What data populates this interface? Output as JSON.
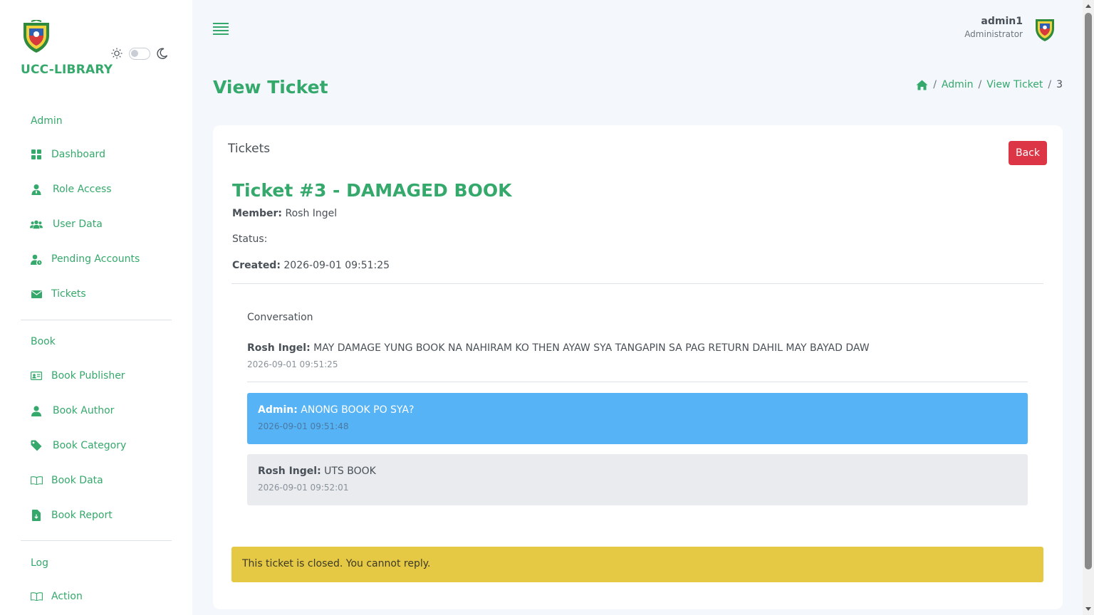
{
  "sidebar": {
    "brand": "UCC-LIBRARY",
    "logo_icon": "ucc-crest",
    "theme": {
      "light_icon": "sun-icon",
      "dark_icon": "moon-icon",
      "dark_mode": false
    },
    "sections": [
      {
        "title": "Admin",
        "items": [
          {
            "label": "Dashboard",
            "icon": "grid-icon"
          },
          {
            "label": "Role Access",
            "icon": "user-tie-icon"
          },
          {
            "label": "User Data",
            "icon": "users-icon"
          },
          {
            "label": "Pending Accounts",
            "icon": "user-clock-icon"
          },
          {
            "label": "Tickets",
            "icon": "envelope-icon"
          }
        ]
      },
      {
        "title": "Book",
        "items": [
          {
            "label": "Book Publisher",
            "icon": "id-card-icon"
          },
          {
            "label": "Book Author",
            "icon": "user-icon"
          },
          {
            "label": "Book Category",
            "icon": "tag-icon"
          },
          {
            "label": "Book Data",
            "icon": "open-book-icon"
          },
          {
            "label": "Book Report",
            "icon": "file-download-icon"
          }
        ]
      },
      {
        "title": "Log",
        "items": [
          {
            "label": "Action",
            "icon": "open-book-icon"
          }
        ]
      }
    ]
  },
  "topbar": {
    "user_name": "admin1",
    "user_role": "Administrator"
  },
  "page": {
    "title": "View Ticket",
    "breadcrumb": [
      "Admin",
      "View Ticket",
      "3"
    ],
    "separator": "/"
  },
  "card": {
    "title": "Tickets",
    "back_label": "Back",
    "ticket_heading": "Ticket #3 - DAMAGED BOOK",
    "member_label": "Member:",
    "member_value": "Rosh Ingel",
    "status_label": "Status:",
    "status_value": "",
    "created_label": "Created:",
    "created_value": "2026-09-01 09:51:25",
    "conversation_label": "Conversation",
    "messages": [
      {
        "author": "Rosh Ingel:",
        "text": "MAY DAMAGE YUNG BOOK NA NAHIRAM KO THEN AYAW SYA TANGAPIN SA PAG RETURN DAHIL MAY BAYAD DAW",
        "time": "2026-09-01 09:51:25"
      },
      {
        "author": "Admin:",
        "text": "ANONG BOOK PO SYA?",
        "time": "2026-09-01 09:51:48"
      },
      {
        "author": "Rosh Ingel:",
        "text": "UTS BOOK",
        "time": "2026-09-01 09:52:01"
      }
    ],
    "closed_notice": "This ticket is closed. You cannot reply."
  },
  "colors": {
    "accent": "#35a86b",
    "danger": "#dc3545",
    "admin_bubble": "#56b3f5",
    "member_bubble": "#e9ebef",
    "warning": "#e5c843"
  }
}
